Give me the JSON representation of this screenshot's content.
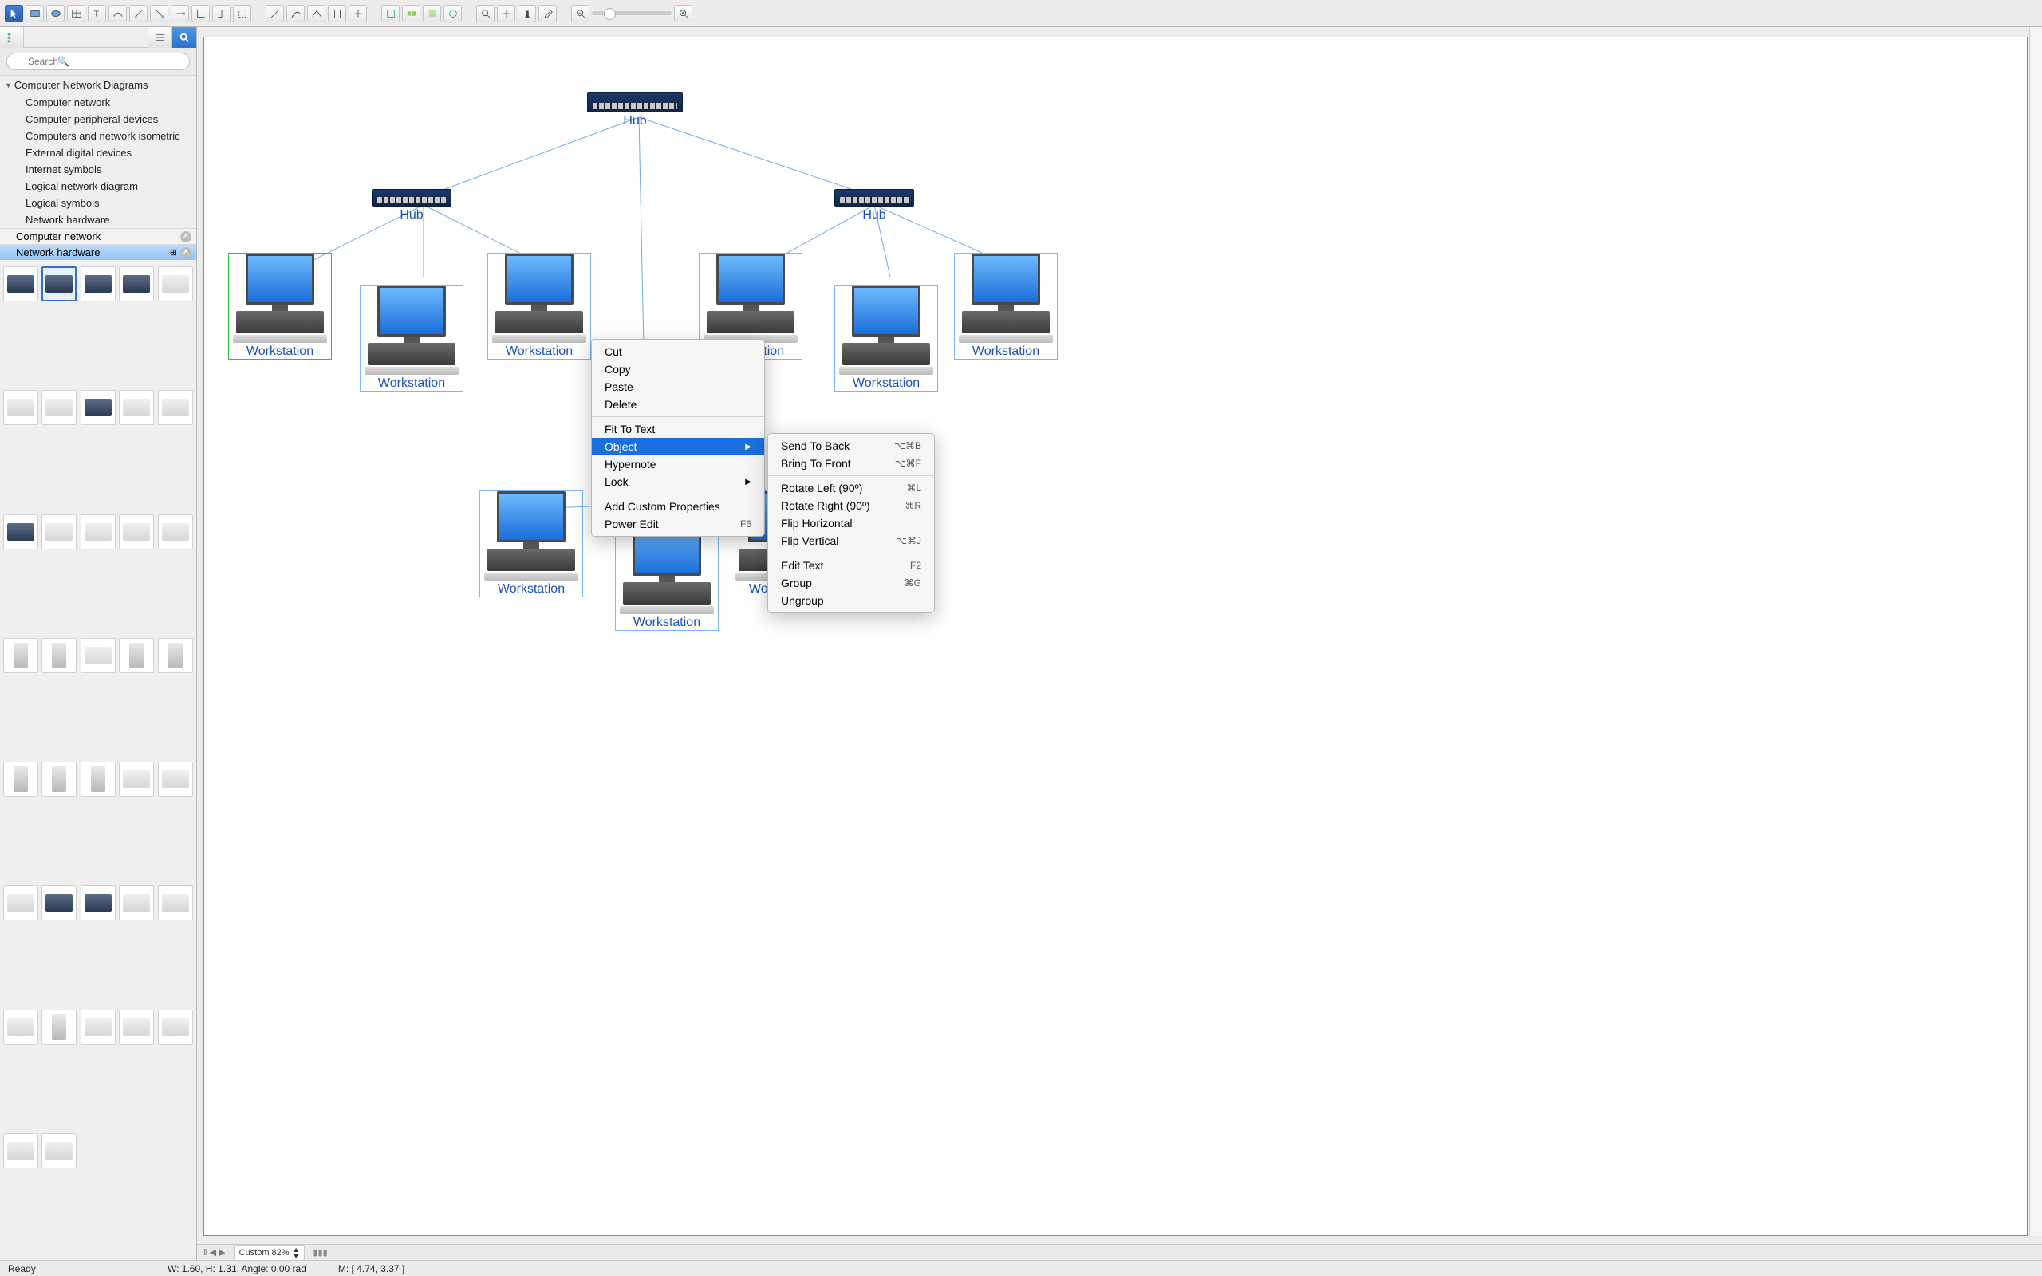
{
  "toolbar": {
    "groups": [
      [
        "pointer",
        "rect",
        "ellipse",
        "table",
        "text",
        "bezier",
        "node-tl",
        "node-tr",
        "node-br",
        "conn1",
        "conn2",
        "conn3"
      ],
      [
        "line1",
        "line2",
        "line3",
        "arrow1",
        "arrow2"
      ],
      [
        "edit1",
        "edit2",
        "edit3",
        "edit4"
      ],
      [
        "zoom-in-tool",
        "pan",
        "stamp",
        "eyedrop"
      ]
    ]
  },
  "sidebar": {
    "search_placeholder": "Search",
    "tree_title": "Computer Network Diagrams",
    "items": [
      "Computer network",
      "Computer peripheral devices",
      "Computers and network isometric",
      "External digital devices",
      "Internet symbols",
      "Logical network diagram",
      "Logical symbols",
      "Network hardware"
    ],
    "open_libs": [
      {
        "name": "Computer network",
        "selected": false
      },
      {
        "name": "Network hardware",
        "selected": true
      }
    ]
  },
  "diagram": {
    "hub_label": "Hub",
    "ws_label": "Workstation"
  },
  "context_menu": {
    "items1": [
      "Cut",
      "Copy",
      "Paste",
      "Delete"
    ],
    "items2": [
      {
        "label": "Fit To Text"
      },
      {
        "label": "Object",
        "sub": true,
        "selected": true
      },
      {
        "label": "Hypernote"
      },
      {
        "label": "Lock",
        "sub": true
      }
    ],
    "items3": [
      {
        "label": "Add Custom Properties"
      },
      {
        "label": "Power Edit",
        "shortcut": "F6"
      }
    ],
    "submenu": [
      {
        "label": "Send To Back",
        "shortcut": "⌥⌘B"
      },
      {
        "label": "Bring To Front",
        "shortcut": "⌥⌘F"
      },
      null,
      {
        "label": "Rotate Left (90º)",
        "shortcut": "⌘L"
      },
      {
        "label": "Rotate Right (90º)",
        "shortcut": "⌘R"
      },
      {
        "label": "Flip Horizontal"
      },
      {
        "label": "Flip Vertical",
        "shortcut": "⌥⌘J"
      },
      null,
      {
        "label": "Edit Text",
        "shortcut": "F2"
      },
      {
        "label": "Group",
        "shortcut": "⌘G"
      },
      {
        "label": "Ungroup"
      }
    ]
  },
  "bottom": {
    "zoom_label": "Custom 82%"
  },
  "status": {
    "ready": "Ready",
    "dims": "W: 1.60,  H: 1.31,  Angle: 0.00 rad",
    "mouse": "M: [ 4.74, 3.37 ]"
  }
}
